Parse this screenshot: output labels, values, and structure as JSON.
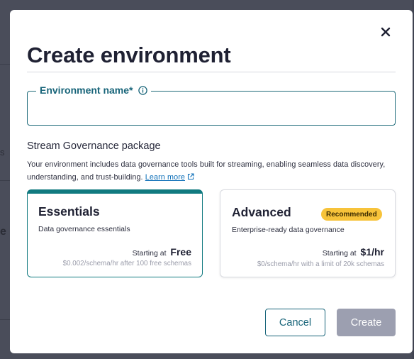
{
  "dialog": {
    "title": "Create environment",
    "close_icon": "close-icon"
  },
  "name_field": {
    "label": "Environment name*",
    "info_icon": "info-icon",
    "value": "",
    "placeholder": ""
  },
  "governance": {
    "section_title": "Stream Governance package",
    "description": "Your environment includes data governance tools built for streaming, enabling seamless data discovery, understanding, and trust-building.",
    "learn_more": "Learn more",
    "learn_more_icon": "external-link-icon",
    "packages": [
      {
        "name": "Essentials",
        "subtitle": "Data governance essentials",
        "price_prefix": "Starting at",
        "price": "Free",
        "note": "$0.002/schema/hr after 100 free schemas",
        "selected": true,
        "badge": ""
      },
      {
        "name": "Advanced",
        "subtitle": "Enterprise-ready data governance",
        "price_prefix": "Starting at",
        "price": "$1/hr",
        "note": "$0/schema/hr with a limit of 20k schemas",
        "selected": false,
        "badge": "Recommended"
      }
    ]
  },
  "actions": {
    "cancel": "Cancel",
    "create": "Create",
    "create_disabled": true
  },
  "background": {
    "glyphs": [
      "s",
      "e",
      "e"
    ]
  },
  "colors": {
    "accent": "#117a80",
    "link": "#0d6fb8",
    "badge": "#f7c33a",
    "disabled_button": "#9c9fb0"
  }
}
